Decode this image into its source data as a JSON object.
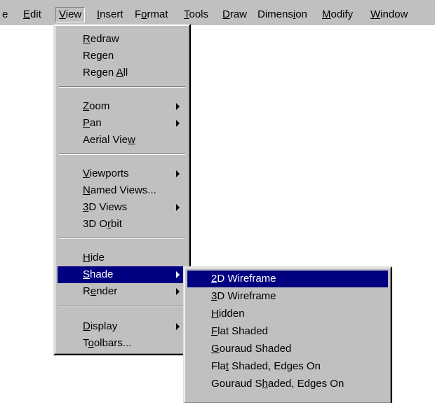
{
  "menubar": {
    "items": [
      {
        "label": "e",
        "ul": -1
      },
      {
        "label": "Edit",
        "ul": 0
      },
      {
        "label": "View",
        "ul": 0
      },
      {
        "label": "Insert",
        "ul": 0
      },
      {
        "label": "Format",
        "ul": 1
      },
      {
        "label": "Tools",
        "ul": 0
      },
      {
        "label": "Draw",
        "ul": 0
      },
      {
        "label": "Dimension",
        "ul": 6
      },
      {
        "label": "Modify",
        "ul": 0
      },
      {
        "label": "Window",
        "ul": 0
      }
    ]
  },
  "view_menu": {
    "items": [
      {
        "label": "Redraw",
        "ul": 0
      },
      {
        "label": "Regen",
        "ul": 2
      },
      {
        "label": "Regen All",
        "ul": 6
      },
      {
        "label": "Zoom",
        "ul": 0,
        "submenu": true
      },
      {
        "label": "Pan",
        "ul": 0,
        "submenu": true
      },
      {
        "label": "Aerial View",
        "ul": 10
      },
      {
        "label": "Viewports",
        "ul": 0,
        "submenu": true
      },
      {
        "label": "Named Views...",
        "ul": 0
      },
      {
        "label": "3D Views",
        "ul": 0,
        "submenu": true
      },
      {
        "label": "3D Orbit",
        "ul": 4
      },
      {
        "label": "Hide",
        "ul": 0
      },
      {
        "label": "Shade",
        "ul": 0,
        "submenu": true,
        "selected": true
      },
      {
        "label": "Render",
        "ul": 1,
        "submenu": true
      },
      {
        "label": "Display",
        "ul": 0,
        "submenu": true
      },
      {
        "label": "Toolbars...",
        "ul": 1
      }
    ]
  },
  "shade_menu": {
    "items": [
      {
        "label": "2D Wireframe",
        "ul": 0,
        "selected": true
      },
      {
        "label": "3D Wireframe",
        "ul": 0
      },
      {
        "label": "Hidden",
        "ul": 0
      },
      {
        "label": "Flat Shaded",
        "ul": 0
      },
      {
        "label": "Gouraud Shaded",
        "ul": 0
      },
      {
        "label": "Flat Shaded, Edges On",
        "ul": 3
      },
      {
        "label": "Gouraud Shaded, Edges On",
        "ul": 9
      }
    ]
  },
  "colors": {
    "menu_face": "#c0c0c0",
    "highlight": "#000080",
    "highlight_text": "#ffffff"
  }
}
